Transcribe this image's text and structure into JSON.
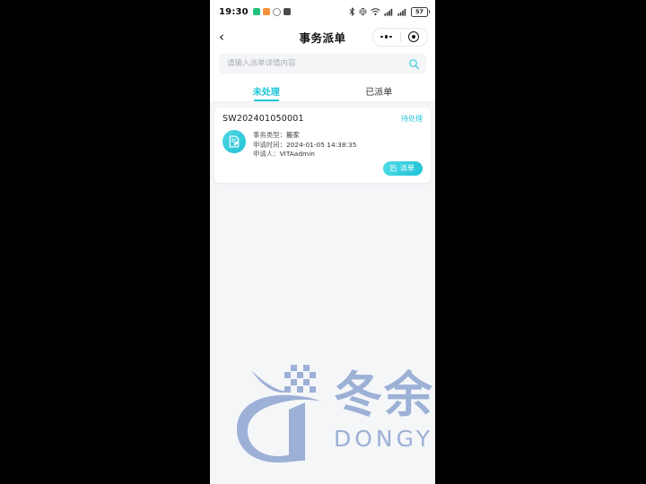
{
  "statusbar": {
    "time": "19:30",
    "left_icons": [
      "wechat-badge-icon",
      "qq-badge-icon",
      "circle-badge-icon",
      "alarm-badge-icon"
    ],
    "right_icons": [
      "bluetooth-icon",
      "vibrate-icon",
      "wifi-icon",
      "signal-icon",
      "signal-icon"
    ],
    "battery_level": "57"
  },
  "navbar": {
    "back_icon": "chevron-left-icon",
    "title": "事务派单",
    "capsule": {
      "menu_icon": "more-dots-icon",
      "close_icon": "target-circle-icon"
    }
  },
  "search": {
    "placeholder": "请输入派单详情内容",
    "value": "",
    "icon": "search-icon"
  },
  "tabs": [
    {
      "label": "未处理",
      "active": true
    },
    {
      "label": "已派单",
      "active": false
    }
  ],
  "list": {
    "cards": [
      {
        "id": "SW202401050001",
        "status": "待处理",
        "avatar_icon": "document-edit-icon",
        "fields": [
          {
            "label": "事务类型：",
            "value": "搬家"
          },
          {
            "label": "申请时间：",
            "value": "2024-01-05 14:38:35"
          },
          {
            "label": "申请人：",
            "value": "VITAadmin"
          }
        ],
        "action": {
          "label": "派单",
          "icon": "dispatch-icon"
        }
      }
    ]
  },
  "watermark": {
    "logo_icon": "dongyu-d-logo-icon",
    "cn_text": "冬余数据",
    "en_text": "DONGYU DATA"
  },
  "colors": {
    "accent": "#1ec6d8",
    "accent_dark": "#1fc2d6",
    "status_text": "#23c3d6",
    "screen_bg": "#f4f6f8",
    "card_bg": "#ffffff",
    "watermark": "#9db0d6",
    "outside_bg": "#000000"
  }
}
